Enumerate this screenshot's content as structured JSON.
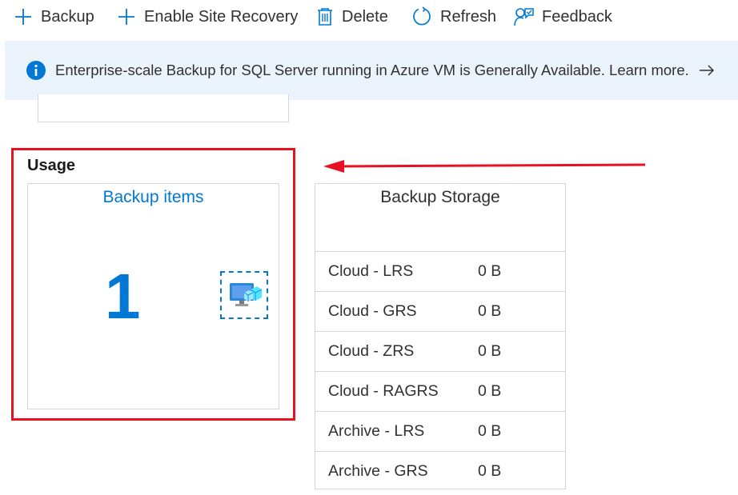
{
  "toolbar": {
    "backup_label": "Backup",
    "site_recovery_label": "Enable Site Recovery",
    "delete_label": "Delete",
    "refresh_label": "Refresh",
    "feedback_label": "Feedback"
  },
  "banner": {
    "text": "Enterprise-scale Backup for SQL Server running in Azure VM is Generally Available. Learn more."
  },
  "usage": {
    "title": "Usage",
    "backup_items": {
      "title": "Backup items",
      "count": "1"
    }
  },
  "backup_storage": {
    "title": "Backup Storage",
    "rows": [
      {
        "name": "Cloud - LRS",
        "value": "0 B"
      },
      {
        "name": "Cloud - GRS",
        "value": "0 B"
      },
      {
        "name": "Cloud - ZRS",
        "value": "0 B"
      },
      {
        "name": "Cloud - RAGRS",
        "value": "0 B"
      },
      {
        "name": "Archive - LRS",
        "value": "0 B"
      },
      {
        "name": "Archive - GRS",
        "value": "0 B"
      }
    ]
  },
  "colors": {
    "accent": "#0078d4",
    "highlight": "#e81123",
    "banner_bg": "#ebf3fc"
  },
  "icons": [
    "plus-icon",
    "plus-icon",
    "trash-icon",
    "refresh-icon",
    "feedback-icon",
    "info-icon",
    "arrow-right-icon",
    "vm-backup-icon"
  ]
}
